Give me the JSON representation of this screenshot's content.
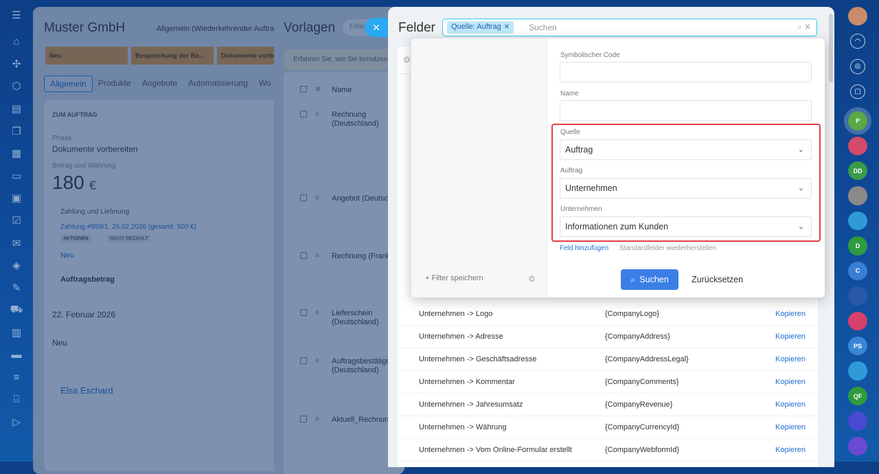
{
  "left_rail": {
    "icons": [
      "hamburger-icon",
      "home-icon",
      "feed-icon",
      "tasks-icon",
      "crm-icon",
      "chat-icon",
      "calendar-icon",
      "inbox-icon",
      "screen-icon",
      "checkbox-icon",
      "mail-icon",
      "sites-icon",
      "sign-icon",
      "shop-icon",
      "catalog-icon",
      "projects-icon",
      "filter-icon",
      "store-icon",
      "more-icon"
    ]
  },
  "right_rail": {
    "avatars": [
      "P",
      "",
      "DD",
      "",
      "",
      "D",
      "C",
      "",
      "",
      "PS",
      "",
      "QF",
      "",
      ""
    ]
  },
  "deal_panel": {
    "title": "Muster GmbH",
    "subtitle": "Allgemein (Wiederkehrender Auftrag)",
    "stages": [
      "Neu",
      "Besprechung der Be...",
      "Dokumente vorbe..."
    ],
    "tabs": [
      "Allgemein",
      "Produkte",
      "Angebote",
      "Automatisierung",
      "Wo"
    ],
    "section": "ZUM AUFTRAG",
    "phase_label": "Phase",
    "phase_value": "Dokumente vorbereiten",
    "amount_label": "Betrag und Währung",
    "amount_value": "180",
    "currency": "€",
    "payment_label": "Zahlung und Lieferung",
    "payment_link": "Zahlung #959/1, 26.02.2026 (gesamt: 500 €)",
    "actions_badge": "AKTIONEN",
    "unpaid_badge": "NICHT BEZAHLT",
    "new_link": "Neu",
    "order_amount": "Auftragsbetrag",
    "date_value": "22. Februar 2026",
    "prev_phase_value": "Neu",
    "contact_name": "Elsa Eschard"
  },
  "templates_panel": {
    "title": "Vorlagen",
    "filter_placeholder": "Filter",
    "info_bar": "Erfahren Sie, wie Sie benutzen",
    "col_name": "Name",
    "rows": [
      "Rechnung (Deutschland)",
      "Angebot (Deutschland)",
      "Rechnung (Frankreich)",
      "Lieferschein (Deutschland)",
      "Auftragsbestätigung (Deutschland)",
      "Aktuell_Rechnung"
    ]
  },
  "felder": {
    "title": "Felder",
    "chip_label": "Quelle: Auftrag",
    "search_placeholder": "Suchen",
    "rows": [
      {
        "name": "Unternehmen -> Logo",
        "code": "{CompanyLogo}",
        "action": "Kopieren"
      },
      {
        "name": "Unternehmen -> Adresse",
        "code": "{CompanyAddress}",
        "action": "Kopieren"
      },
      {
        "name": "Unternehmen -> Geschäftsadresse",
        "code": "{CompanyAddressLegal}",
        "action": "Kopieren"
      },
      {
        "name": "Unternehmen -> Kommentar",
        "code": "{CompanyComments}",
        "action": "Kopieren"
      },
      {
        "name": "Unternehmen -> Jahresumsatz",
        "code": "{CompanyRevenue}",
        "action": "Kopieren"
      },
      {
        "name": "Unternehmen -> Währung",
        "code": "{CompanyCurrencyId}",
        "action": "Kopieren"
      },
      {
        "name": "Unternehmen -> Vom Online-Formular erstellt",
        "code": "{CompanyWebformId}",
        "action": "Kopieren"
      }
    ]
  },
  "filter_popup": {
    "save_filter": "+ Filter speichern",
    "symbolic_code_label": "Symbolischer Code",
    "symbolic_code_value": "",
    "name_label": "Name",
    "name_value": "",
    "source_label": "Quelle",
    "source_value": "Auftrag",
    "order_label": "Auftrag",
    "order_value": "Unternehmen",
    "company_label": "Unternehmen",
    "company_value": "Informationen zum Kunden",
    "add_field": "Feld hinzufügen",
    "restore_fields": "Standardfelder wiederherstellen",
    "search_button": "Suchen",
    "reset_button": "Zurücksetzen"
  },
  "colors": {
    "accent": "#3b7ee6",
    "highlight": "#e0404a",
    "chip": "#bfe7fa",
    "link": "#1f6fd1",
    "stage": "#f0a038"
  }
}
